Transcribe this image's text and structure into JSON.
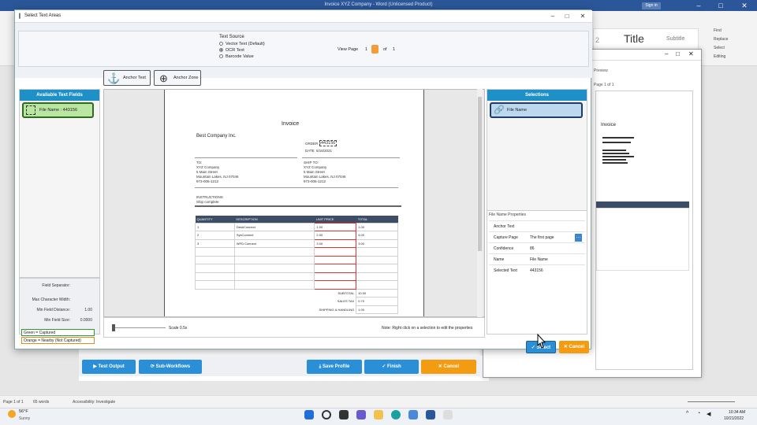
{
  "word": {
    "title": "Invoice XYZ Company - Word (Unlicensed Product)",
    "sign_in": "Sign in",
    "styles": [
      "2",
      "Title",
      "Subtitle"
    ],
    "editing": [
      "Find",
      "Replace",
      "Select",
      "Editing"
    ]
  },
  "preview": {
    "label": "Preview",
    "page_of": "Page 1 of 1"
  },
  "dialog": {
    "title": "Select Text Areas",
    "text_source": {
      "title": "Text Source",
      "options": [
        "Vector Text (Default)",
        "OCR Text",
        "Barcode Value"
      ],
      "selected": "OCR Text"
    },
    "view_page": {
      "label": "View Page",
      "current": "1",
      "of": "of",
      "total": "1"
    },
    "anchor_text_btn": "Anchor Text",
    "anchor_zone_btn": "Anchor Zone",
    "available_fields": {
      "title": "Available Text Fields",
      "items": [
        "File Name : 443156"
      ]
    },
    "left_settings": {
      "field_separator": "Field Separator:",
      "max_char_width": "Max Character Width:",
      "min_field_distance": "Min Field Distance:",
      "min_field_distance_val": "1.00",
      "min_field_size": "Min Field Size:",
      "min_field_size_val": "0.0000"
    },
    "legend": {
      "green": "Green = Captured",
      "orange": "Orange = Nearby (Not Captured)"
    },
    "document": {
      "heading": "Invoice",
      "company": "Best Company Inc.",
      "order_label": "ORDER #",
      "order_value": "443156",
      "date_label": "DATE",
      "date_value": "5/16/2021",
      "to_label": "TO:",
      "to_lines": [
        "XYZ Company",
        "5 Main Street",
        "Mountain Lakes, NJ 07046",
        "973-006-1212"
      ],
      "ship_label": "SHIP TO:",
      "ship_lines": [
        "XYZ Company",
        "5 Main Street",
        "Mountain Lakes, NJ 07046",
        "973-006-1212"
      ],
      "instructions_label": "INSTRUCTIONS",
      "instructions": "Ship complete",
      "table_headers": [
        "QUANTITY",
        "DESCRIPTION",
        "UNIT PRICE",
        "TOTAL"
      ],
      "rows": [
        [
          "1",
          "DeskConnect",
          "1.00",
          "1.00"
        ],
        [
          "2",
          "SysConnect",
          "2.00",
          "4.00"
        ],
        [
          "3",
          "WFD Connect",
          "3.00",
          "3.00"
        ]
      ],
      "subtotal_label": "SUBTOTAL",
      "subtotal": "10.00",
      "sales_tax_label": "SALES TAX",
      "sales_tax": "0.70",
      "shipping_label": "SHIPPING & HANDLING",
      "shipping": "1.00"
    },
    "scale": "Scale 0.5x",
    "note": "Note: Right click on a selection to edit the properties",
    "selections": {
      "title": "Selections",
      "items": [
        "File Name"
      ]
    },
    "properties": {
      "title": "File Name Properties",
      "rows": [
        {
          "k": "Anchor Text",
          "v": ""
        },
        {
          "k": "Capture Page",
          "v": "The first page"
        },
        {
          "k": "Confidence",
          "v": "86"
        },
        {
          "k": "Name",
          "v": "File Name"
        },
        {
          "k": "Selected Text",
          "v": "443156"
        }
      ]
    },
    "select_btn": "Select",
    "cancel_btn": "Cancel"
  },
  "bottom_bar": {
    "test_output": "Test Output",
    "sub_workflows": "Sub-Workflows",
    "save_profile": "Save Profile",
    "finish": "Finish",
    "cancel": "Cancel"
  },
  "statusbar": {
    "page": "Page 1 of 1",
    "words": "65 words",
    "accessibility": "Accessibility: Investigate"
  },
  "taskbar": {
    "temp": "56°F",
    "condition": "Sunny",
    "time": "10:34 AM",
    "date": "10/21/2022"
  },
  "colors": {
    "accent": "#1e90c8",
    "orange": "#f39c12",
    "green": "#b9e6a0",
    "table_header": "#3d4d66"
  }
}
